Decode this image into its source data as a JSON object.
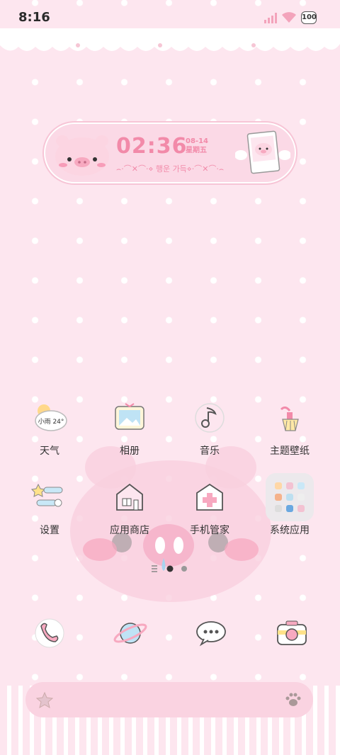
{
  "status_bar": {
    "time": "8:16",
    "battery": "100"
  },
  "clock_widget": {
    "time": "02:36",
    "date": "08-14",
    "weekday": "星期五",
    "message": "⌢·⌒✕⌒·⋄ 행운 가득⋄·⌒✕⌒·⌢"
  },
  "apps": [
    {
      "label": "天气",
      "icon": "weather-icon",
      "badge": "小雨 24°"
    },
    {
      "label": "相册",
      "icon": "photo-album-icon"
    },
    {
      "label": "音乐",
      "icon": "music-icon"
    },
    {
      "label": "主题壁纸",
      "icon": "theme-wallpaper-icon"
    },
    {
      "label": "设置",
      "icon": "settings-icon"
    },
    {
      "label": "应用商店",
      "icon": "app-store-icon"
    },
    {
      "label": "手机管家",
      "icon": "phone-manager-icon"
    },
    {
      "label": "系统应用",
      "icon": "system-apps-folder-icon"
    }
  ],
  "dock": [
    {
      "icon": "phone-icon"
    },
    {
      "icon": "browser-planet-icon"
    },
    {
      "icon": "messages-icon"
    },
    {
      "icon": "camera-icon"
    }
  ],
  "pager": {
    "pages": 2,
    "current": 1
  },
  "colors": {
    "background": "#fde6ef",
    "accent": "#f28aa9",
    "widget": "#fbd9e6"
  }
}
